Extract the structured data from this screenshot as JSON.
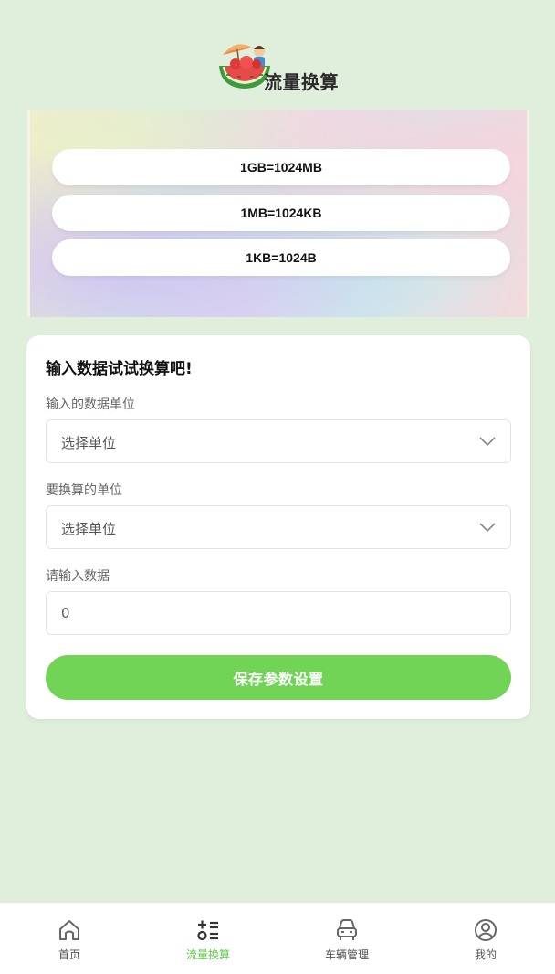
{
  "header": {
    "title": "流量换算"
  },
  "banner": {
    "rules": [
      "1GB=1024MB",
      "1MB=1024KB",
      "1KB=1024B"
    ]
  },
  "form": {
    "heading": "输入数据试试换算吧!",
    "from_unit_label": "输入的数据单位",
    "from_unit_value": "选择单位",
    "to_unit_label": "要换算的单位",
    "to_unit_value": "选择单位",
    "data_label": "请输入数据",
    "data_value": "0",
    "save_label": "保存参数设置"
  },
  "tabbar": {
    "items": [
      {
        "label": "首页",
        "icon": "home-icon",
        "active": false
      },
      {
        "label": "流量换算",
        "icon": "calculator-icon",
        "active": true
      },
      {
        "label": "车辆管理",
        "icon": "car-icon",
        "active": false
      },
      {
        "label": "我的",
        "icon": "user-icon",
        "active": false
      }
    ]
  },
  "colors": {
    "accent": "#72d457",
    "active_tab": "#62c94a",
    "background": "#e0efdc"
  }
}
